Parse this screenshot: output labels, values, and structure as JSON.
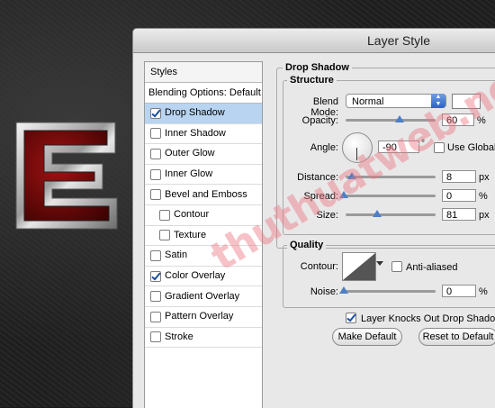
{
  "window": {
    "title": "Layer Style"
  },
  "styles_panel": {
    "header": "Styles",
    "blending": "Blending Options: Default",
    "items": [
      {
        "label": "Drop Shadow",
        "checked": true,
        "selected": true
      },
      {
        "label": "Inner Shadow",
        "checked": false
      },
      {
        "label": "Outer Glow",
        "checked": false
      },
      {
        "label": "Inner Glow",
        "checked": false
      },
      {
        "label": "Bevel and Emboss",
        "checked": false
      },
      {
        "label": "Contour",
        "checked": false,
        "sub": true
      },
      {
        "label": "Texture",
        "checked": false,
        "sub": true
      },
      {
        "label": "Satin",
        "checked": false
      },
      {
        "label": "Color Overlay",
        "checked": true
      },
      {
        "label": "Gradient Overlay",
        "checked": false
      },
      {
        "label": "Pattern Overlay",
        "checked": false
      },
      {
        "label": "Stroke",
        "checked": false
      }
    ]
  },
  "drop_shadow": {
    "title": "Drop Shadow",
    "structure_title": "Structure",
    "blend_mode_label": "Blend Mode:",
    "blend_mode_value": "Normal",
    "opacity_label": "Opacity:",
    "opacity_value": "60",
    "opacity_level": 0.6,
    "angle_label": "Angle:",
    "angle_value": "-90",
    "degree_symbol": "°",
    "use_global_light": "Use Global L",
    "distance_label": "Distance:",
    "distance_value": "8",
    "spread_label": "Spread:",
    "spread_value": "0",
    "size_label": "Size:",
    "size_value": "81",
    "unit_percent": "%",
    "unit_px": "px",
    "quality_title": "Quality",
    "contour_label": "Contour:",
    "anti_aliased": "Anti-aliased",
    "noise_label": "Noise:",
    "noise_value": "0",
    "knockout_label": "Layer Knocks Out Drop Shadow",
    "knockout_checked": true,
    "make_default": "Make Default",
    "reset_default": "Reset to Default"
  },
  "watermark": "thuthuatweb.net",
  "logo_letter": "E",
  "colors": {
    "accent": "#b8d4f0",
    "logo_red": "#8c0a0a"
  }
}
